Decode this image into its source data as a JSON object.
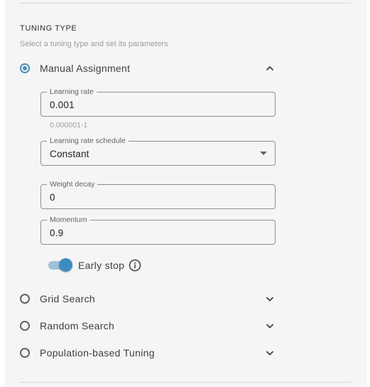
{
  "section": {
    "title": "TUNING TYPE",
    "subtitle": "Select a tuning type and set its parameters"
  },
  "options": [
    {
      "label": "Manual Assignment",
      "selected": true,
      "expanded": true
    },
    {
      "label": "Grid Search",
      "selected": false,
      "expanded": false
    },
    {
      "label": "Random Search",
      "selected": false,
      "expanded": false
    },
    {
      "label": "Population-based Tuning",
      "selected": false,
      "expanded": false
    }
  ],
  "manual": {
    "learning_rate": {
      "label": "Learning rate",
      "value": "0.001",
      "hint": "0.000001-1"
    },
    "schedule": {
      "label": "Learning rate schedule",
      "value": "Constant"
    },
    "weight_decay": {
      "label": "Weight decay",
      "value": "0"
    },
    "momentum": {
      "label": "Momentum",
      "value": "0.9"
    },
    "early_stop": {
      "label": "Early stop",
      "enabled": true
    }
  },
  "icons": {
    "chevron_up": "chevron-up-icon",
    "chevron_down": "chevron-down-icon",
    "info": "info-icon",
    "dropdown": "caret-down-icon"
  },
  "colors": {
    "accent": "#4a90b8",
    "toggle_thumb": "#3e8cc0",
    "toggle_track": "#9fc1d7",
    "panel_bg": "#f5f5f5"
  }
}
